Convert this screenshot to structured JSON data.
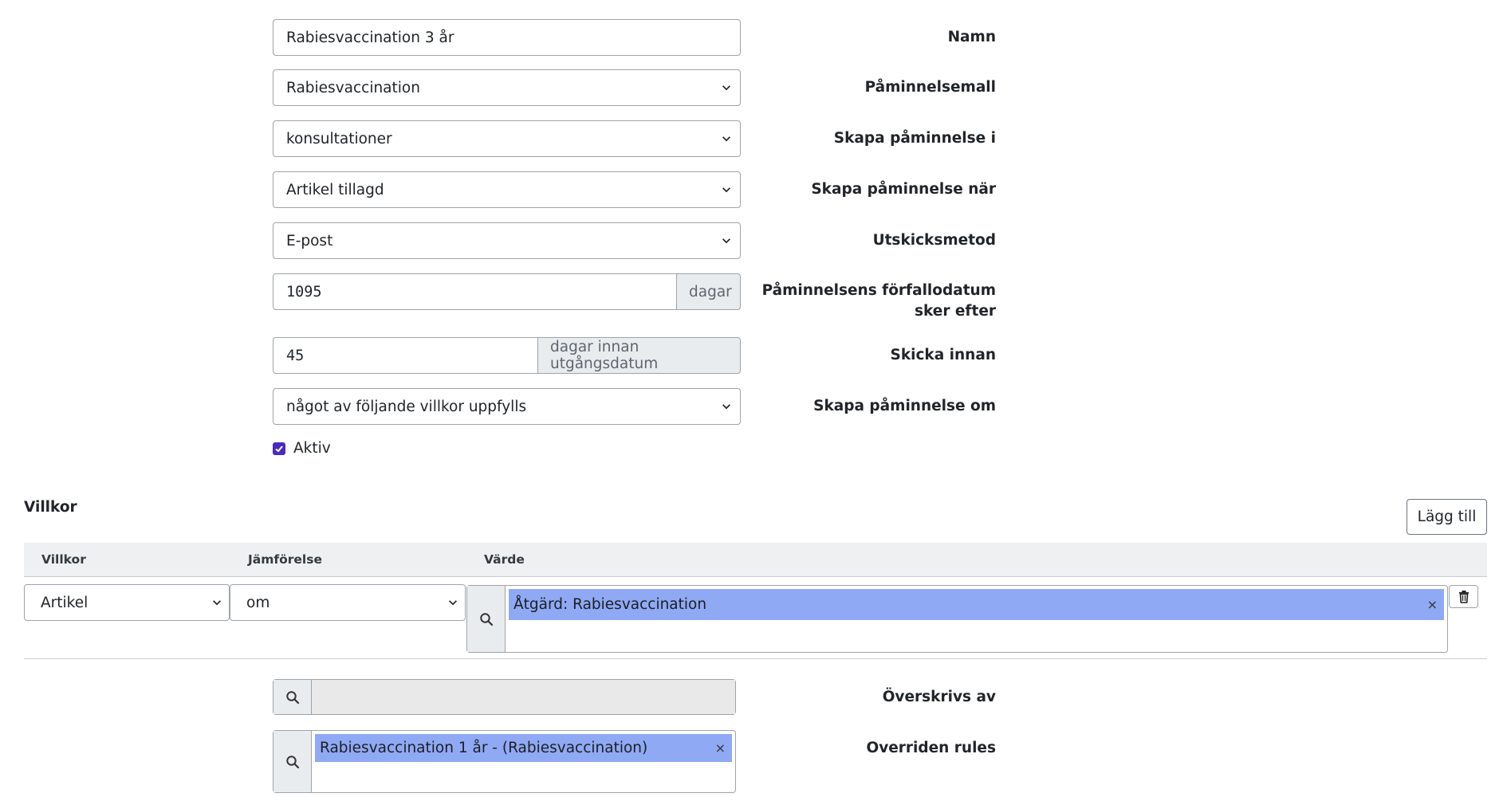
{
  "form": {
    "name": {
      "label": "Namn",
      "value": "Rabiesvaccination 3 år"
    },
    "template": {
      "label": "Påminnelsemall",
      "value": "Rabiesvaccination"
    },
    "create_in": {
      "label": "Skapa påminnelse i",
      "value": "konsultationer"
    },
    "create_when": {
      "label": "Skapa påminnelse när",
      "value": "Artikel tillagd"
    },
    "send_method": {
      "label": "Utskicksmetod",
      "value": "E-post"
    },
    "due_after": {
      "label_line1": "Påminnelsens förfallodatum",
      "label_line2": "sker efter",
      "value": "1095",
      "addon": "dagar"
    },
    "send_before": {
      "label": "Skicka innan",
      "value": "45",
      "addon": "dagar innan utgångsdatum"
    },
    "create_if": {
      "label": "Skapa påminnelse om",
      "value": "något av följande villkor uppfylls"
    },
    "active": {
      "label": "Aktiv",
      "checked": true
    }
  },
  "conditions": {
    "title": "Villkor",
    "add_button": "Lägg till",
    "headers": [
      "Villkor",
      "Jämförelse",
      "Värde"
    ],
    "row": {
      "condition": "Artikel",
      "comparison": "om",
      "value_tag": "Åtgärd: Rabiesvaccination"
    }
  },
  "overrides": {
    "overwritten_by": {
      "label": "Överskrivs av"
    },
    "overridden_rules": {
      "label": "Overriden rules",
      "tag": "Rabiesvaccination 1 år - (Rabiesvaccination)"
    }
  },
  "colors": {
    "tag_bg": "#8fa9f4",
    "checkbox": "#4a2bbd",
    "header_bg": "#eef0f1"
  }
}
